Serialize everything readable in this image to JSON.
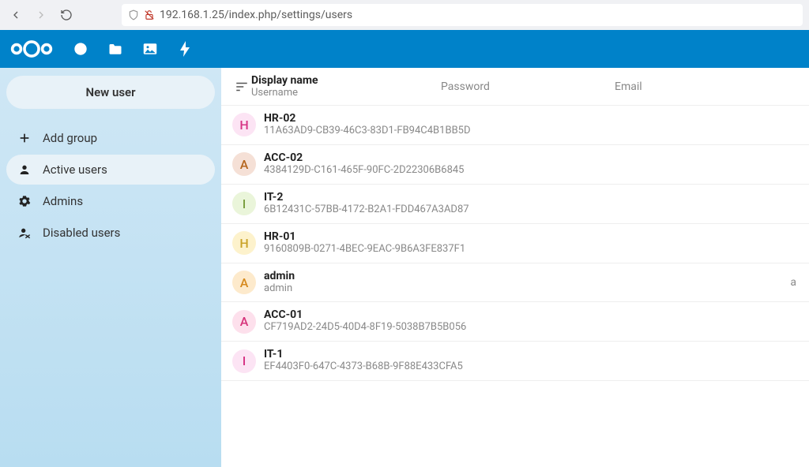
{
  "browser": {
    "url": "192.168.1.25/index.php/settings/users"
  },
  "sidebar": {
    "new_user_label": "New user",
    "items": [
      {
        "label": "Add group"
      },
      {
        "label": "Active users"
      },
      {
        "label": "Admins"
      },
      {
        "label": "Disabled users"
      }
    ]
  },
  "table": {
    "headers": {
      "display_name": "Display name",
      "username": "Username",
      "password": "Password",
      "email": "Email"
    }
  },
  "users": [
    {
      "letter": "H",
      "color_bg": "#fce4f4",
      "color_fg": "#d63384",
      "display_name": "HR-02",
      "username": "11A63AD9-CB39-46C3-83D1-FB94C4B1BB5D",
      "trail": ""
    },
    {
      "letter": "A",
      "color_bg": "#f5e0d6",
      "color_fg": "#b5651d",
      "display_name": "ACC-02",
      "username": "4384129D-C161-465F-90FC-2D22306B6845",
      "trail": ""
    },
    {
      "letter": "I",
      "color_bg": "#eaf5da",
      "color_fg": "#7a9e3f",
      "display_name": "IT-2",
      "username": "6B12431C-57BB-4172-B2A1-FDD467A3AD87",
      "trail": ""
    },
    {
      "letter": "H",
      "color_bg": "#fdf2cc",
      "color_fg": "#c9a227",
      "display_name": "HR-01",
      "username": "9160809B-0271-4BEC-9EAC-9B6A3FE837F1",
      "trail": ""
    },
    {
      "letter": "A",
      "color_bg": "#fdeacc",
      "color_fg": "#d68a1e",
      "display_name": "admin",
      "username": "admin",
      "trail": "a"
    },
    {
      "letter": "A",
      "color_bg": "#fde0ec",
      "color_fg": "#d6337a",
      "display_name": "ACC-01",
      "username": "CF719AD2-24D5-40D4-8F19-5038B7B5B056",
      "trail": ""
    },
    {
      "letter": "I",
      "color_bg": "#fce4f4",
      "color_fg": "#d63384",
      "display_name": "IT-1",
      "username": "EF4403F0-647C-4373-B68B-9F88E433CFA5",
      "trail": ""
    }
  ]
}
